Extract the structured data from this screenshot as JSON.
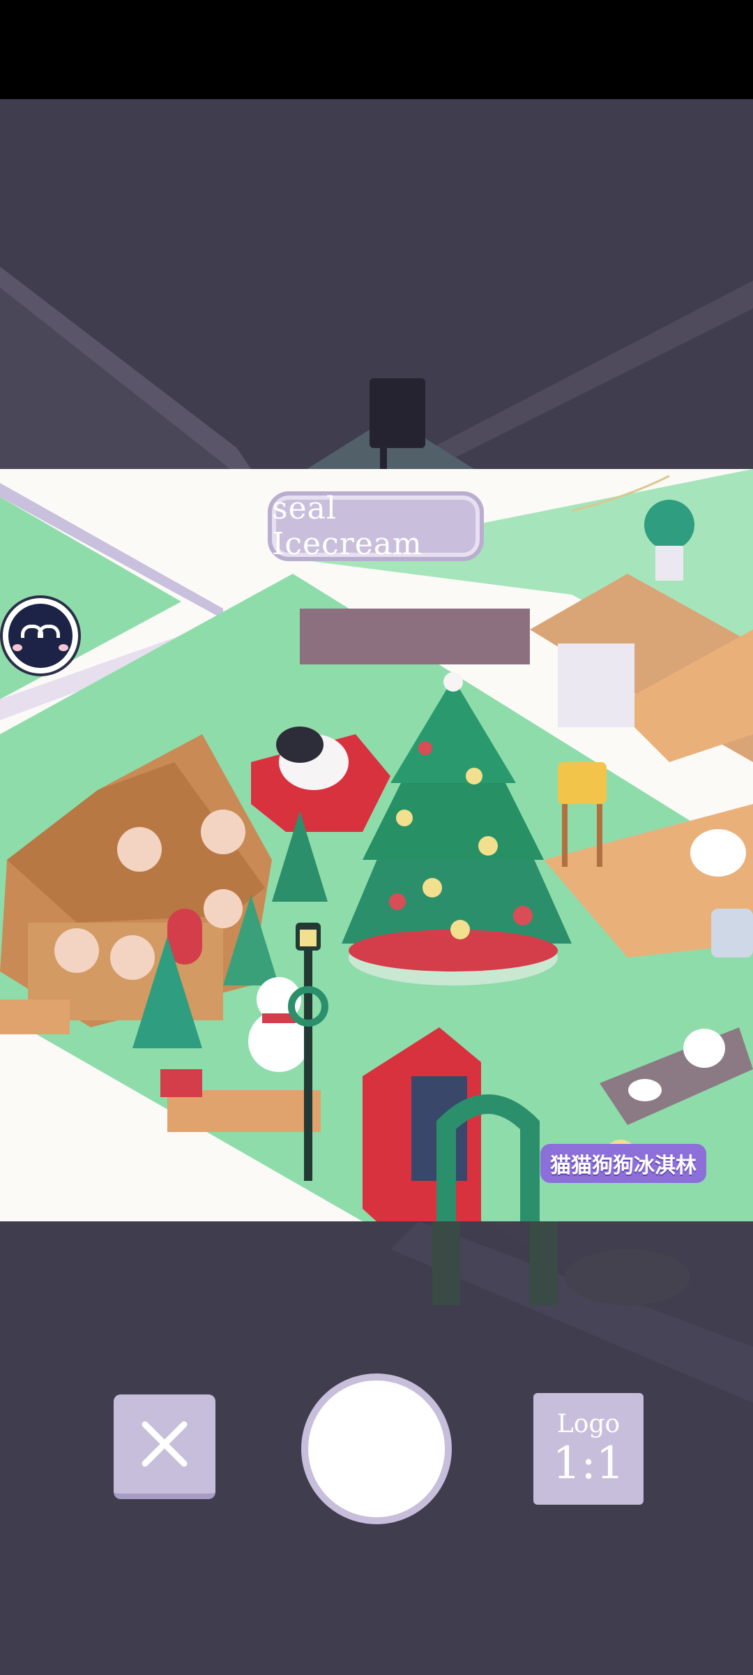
{
  "scene": {
    "shop_name": "seal Icecream",
    "shop_banner": "猫猫狗狗冰淇林"
  },
  "controls": {
    "close_icon": "close-icon",
    "shutter": "camera-shutter",
    "ratio_logo_label": "Logo",
    "ratio_value": "1:1"
  },
  "colors": {
    "background": "#3e3c4c",
    "button_lavender": "#c7bedb",
    "grass": "#8fdcab",
    "tree": "#2b8f6c"
  }
}
